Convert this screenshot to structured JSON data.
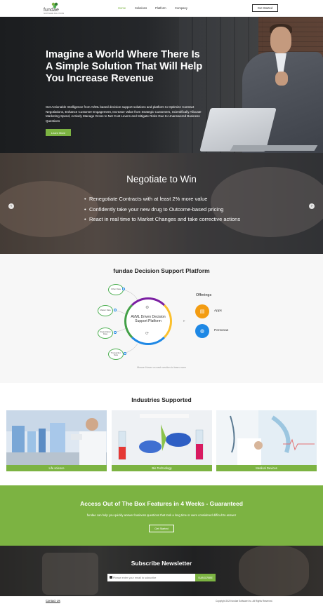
{
  "header": {
    "logo_text": "fundae",
    "logo_tagline": "SOFTWARE SOLUTIONS",
    "nav": [
      "Home",
      "Solutions",
      "Platform",
      "Company"
    ],
    "cta": "Get Started"
  },
  "hero": {
    "title": "Imagine a World Where There Is A Simple Solution That Will Help You Increase Revenue",
    "subtitle": "Get Actionable Intelligence from AI/ML based decision support solutions and platform to Optimize Contract Negotiations, Enhance Customer Engagement, Increase Value from Strategic Customers, Scientifically Allocate Marketing Spend, Actively Manage Gross to Net Cost Levers and Mitigate Risks Due to Unanswered Business Questions",
    "button": "Learn More"
  },
  "slider": {
    "title": "Negotiate to Win",
    "bullets": [
      "Renegotiate Contracts with at least 2% more value",
      "Confidently take your new drug to Outcome-based pricing",
      "React in real time to Market Changes and take corrective actions"
    ]
  },
  "platform": {
    "title": "fundae Decision Support Platform",
    "center_text": "AI/ML Driven Decision Support Platform",
    "nodes": [
      "Other Data",
      "Master Data",
      "Organization Data",
      "Transaction Data"
    ],
    "offerings_title": "Offerings",
    "offerings": [
      "Apps",
      "Personas"
    ],
    "caption": "Mouse Hover on each section to learn more"
  },
  "industries": {
    "title": "Industries Supported",
    "items": [
      "Life science",
      "Bio Technology",
      "Medical Devices"
    ]
  },
  "banner": {
    "title": "Access Out of The Box Features in 4 Weeks - Guaranteed",
    "subtitle": "fundae can help you quickly answer business questions that took a long time or were considered difficult to answer",
    "button": "Get Started"
  },
  "newsletter": {
    "title": "Subscribe Newsletter",
    "placeholder": "Please enter your email to subscribe",
    "button": "SUBSCRIBE"
  },
  "footer": {
    "contact": "Contact Us",
    "copyright": "Copyright 2020 fundae Software Inc. All Rights Reserved."
  },
  "colors": {
    "accent": "#7cb342",
    "apps_icon": "#f39c12",
    "personas_icon": "#1e88e5"
  }
}
